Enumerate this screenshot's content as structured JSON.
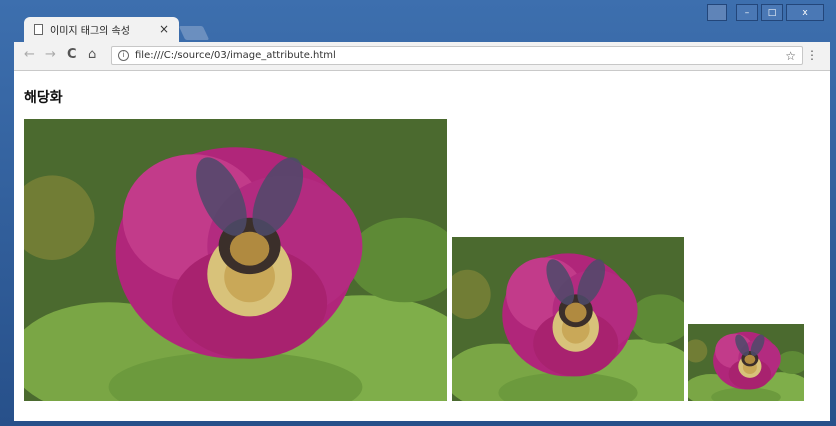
{
  "tab": {
    "title": "이미지 태그의 속성",
    "close_glyph": "×"
  },
  "window_buttons": {
    "minimize": "–",
    "maximize": "□",
    "close": "x"
  },
  "toolbar": {
    "back": "←",
    "forward": "→",
    "reload": "C",
    "home": "⌂",
    "bookmark": "☆",
    "menu": "⋮"
  },
  "address": {
    "url": "file:///C:/source/03/image_attribute.html",
    "info_icon": "i"
  },
  "page": {
    "heading": "해당화"
  },
  "images": [
    {
      "name": "large-flower-image",
      "subject": "pink rose with bumblebee"
    },
    {
      "name": "medium-flower-image",
      "subject": "pink rose with bumblebee"
    },
    {
      "name": "small-flower-image",
      "subject": "pink rose with bumblebee"
    }
  ]
}
